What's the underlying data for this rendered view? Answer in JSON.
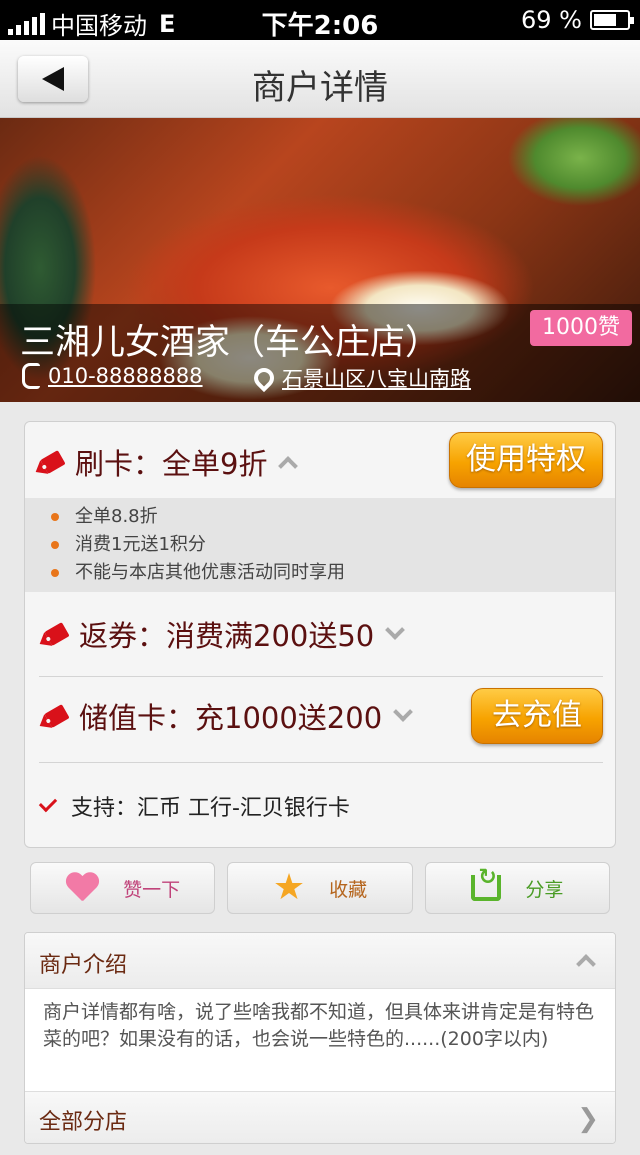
{
  "status_bar": {
    "carrier": "中国移动",
    "network": "E",
    "time": "下午2:06",
    "battery": "69 %",
    "battery_level": 0.69
  },
  "nav": {
    "title": "商户详情",
    "back_icon": "back-arrow-icon"
  },
  "merchant": {
    "name": "三湘儿女酒家（车公庄店）",
    "likes": "1000赞",
    "phone": "010-88888888",
    "address": "石景山区八宝山南路"
  },
  "privileges": {
    "card_label": "刷卡：全单9折",
    "use_button": "使用特权",
    "card_details": [
      "全单8.8折",
      "消费1元送1积分",
      "不能与本店其他优惠活动同时享用"
    ],
    "coupon_label": "返券：消费满200送50",
    "stored_value_label": "储值卡：充1000送200",
    "recharge_button": "去充值",
    "support": "支持：汇币  工行-汇贝银行卡"
  },
  "actions": {
    "like": "赞一下",
    "favorite": "收藏",
    "share": "分享"
  },
  "intro": {
    "title": "商户介绍",
    "body": "商户详情都有啥，说了些啥我都不知道，但具体来讲肯定是有特色菜的吧？如果没有的话，也会说一些特色的......(200字以内)",
    "branches": "全部分店"
  },
  "colors": {
    "accent_orange": "#f7a300",
    "tag_red": "#d9111a",
    "likes_pink": "#f26aa0",
    "label_brown": "#5b1010"
  }
}
